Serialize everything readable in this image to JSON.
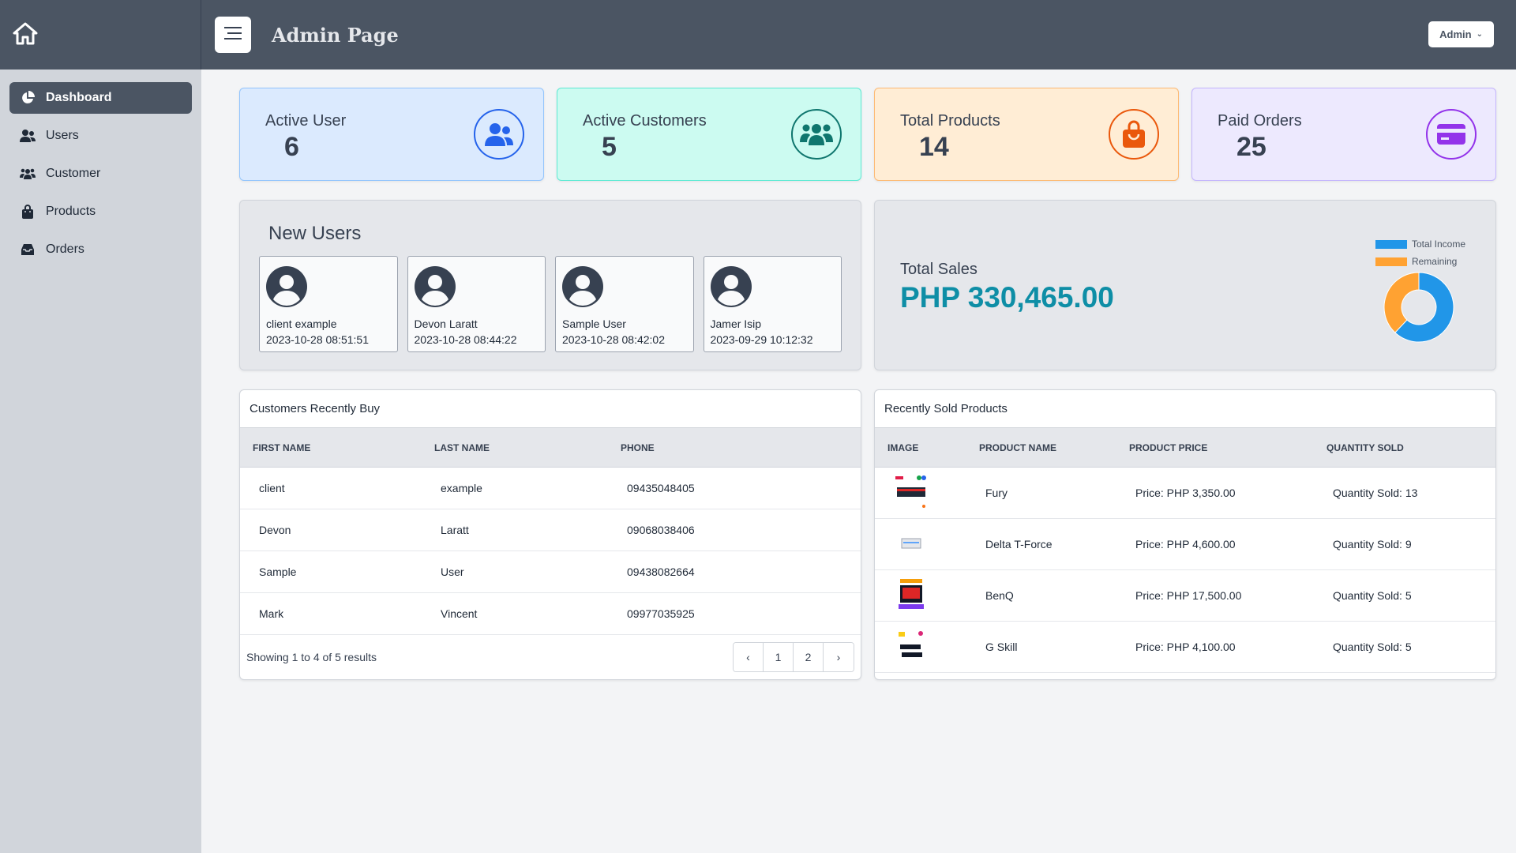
{
  "header": {
    "title": "Admin Page",
    "user_menu": "Admin"
  },
  "sidebar": {
    "items": [
      {
        "label": "Dashboard",
        "icon": "chart-pie-icon",
        "active": true
      },
      {
        "label": "Users",
        "icon": "users-icon"
      },
      {
        "label": "Customer",
        "icon": "people-group-icon"
      },
      {
        "label": "Products",
        "icon": "shopping-bag-icon"
      },
      {
        "label": "Orders",
        "icon": "inbox-icon"
      }
    ]
  },
  "stats": [
    {
      "label": "Active User",
      "value": "6",
      "icon": "users-icon",
      "color": "#2563eb"
    },
    {
      "label": "Active Customers",
      "value": "5",
      "icon": "people-group-icon",
      "color": "#0f766e"
    },
    {
      "label": "Total Products",
      "value": "14",
      "icon": "shopping-bag-icon",
      "color": "#ea580c"
    },
    {
      "label": "Paid Orders",
      "value": "25",
      "icon": "credit-card-icon",
      "color": "#9333ea"
    }
  ],
  "new_users": {
    "title": "New Users",
    "users": [
      {
        "name": "client example",
        "date": "2023-10-28 08:51:51"
      },
      {
        "name": "Devon Laratt",
        "date": "2023-10-28 08:44:22"
      },
      {
        "name": "Sample User",
        "date": "2023-10-28 08:42:02"
      },
      {
        "name": "Jamer Isip",
        "date": "2023-09-29 10:12:32"
      }
    ]
  },
  "sales": {
    "label": "Total Sales",
    "value": "PHP 330,465.00",
    "chart_data": {
      "type": "pie",
      "legend": [
        "Total Income",
        "Remaining"
      ],
      "colors": [
        "#2196e8",
        "#ffa232"
      ],
      "values": [
        0.62,
        0.38
      ],
      "legend_position": "top-right"
    }
  },
  "customers": {
    "title": "Customers Recently Buy",
    "columns": [
      "FIRST NAME",
      "LAST NAME",
      "PHONE"
    ],
    "rows": [
      [
        "client",
        "example",
        "09435048405"
      ],
      [
        "Devon",
        "Laratt",
        "09068038406"
      ],
      [
        "Sample",
        "User",
        "09438082664"
      ],
      [
        "Mark",
        "Vincent",
        "09977035925"
      ]
    ],
    "footer": "Showing 1 to 4 of 5 results",
    "pages": [
      "1",
      "2"
    ]
  },
  "products": {
    "title": "Recently Sold Products",
    "columns": [
      "IMAGE",
      "PRODUCT NAME",
      "PRODUCT PRICE",
      "QUANTITY SOLD"
    ],
    "rows": [
      {
        "name": "Fury",
        "price": "Price: PHP 3,350.00",
        "qty": "Quantity Sold: 13"
      },
      {
        "name": "Delta T-Force",
        "price": "Price: PHP 4,600.00",
        "qty": "Quantity Sold: 9"
      },
      {
        "name": "BenQ",
        "price": "Price: PHP 17,500.00",
        "qty": "Quantity Sold: 5"
      },
      {
        "name": "G Skill",
        "price": "Price: PHP 4,100.00",
        "qty": "Quantity Sold: 5"
      }
    ]
  }
}
